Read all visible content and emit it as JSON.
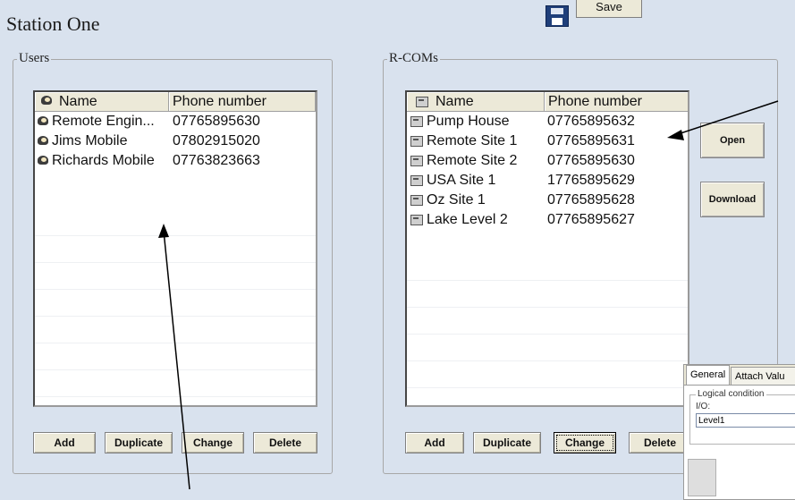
{
  "window": {
    "title": "Station One"
  },
  "toolbar": {
    "save_label": "Save"
  },
  "users": {
    "group_label": "Users",
    "columns": [
      "Name",
      "Phone number"
    ],
    "rows": [
      {
        "name": "Remote Engin...",
        "phone": "07765895630"
      },
      {
        "name": "Jims Mobile",
        "phone": "07802915020"
      },
      {
        "name": "Richards Mobile",
        "phone": "07763823663"
      }
    ],
    "buttons": {
      "add": "Add",
      "duplicate": "Duplicate",
      "change": "Change",
      "delete": "Delete"
    }
  },
  "rcoms": {
    "group_label": "R-COMs",
    "columns": [
      "Name",
      "Phone number"
    ],
    "rows": [
      {
        "name": "Pump House",
        "phone": "07765895632"
      },
      {
        "name": "Remote Site 1",
        "phone": "07765895631"
      },
      {
        "name": "Remote Site 2",
        "phone": "07765895630"
      },
      {
        "name": "USA Site 1",
        "phone": "17765895629"
      },
      {
        "name": "Oz Site 1",
        "phone": "07765895628"
      },
      {
        "name": "Lake Level 2",
        "phone": "07765895627"
      }
    ],
    "buttons": {
      "add": "Add",
      "duplicate": "Duplicate",
      "change": "Change",
      "delete": "Delete"
    },
    "side_buttons": {
      "open": "Open",
      "download": "Download"
    }
  },
  "properties": {
    "tabs": [
      "General",
      "Attach Valu"
    ],
    "group_label": "Logical condition",
    "io_label": "I/O:",
    "io_value": "Level1"
  },
  "icons": {
    "user_row": "user-icon",
    "rcom_row": "rcom-device-icon",
    "save": "floppy-disk-icon"
  }
}
